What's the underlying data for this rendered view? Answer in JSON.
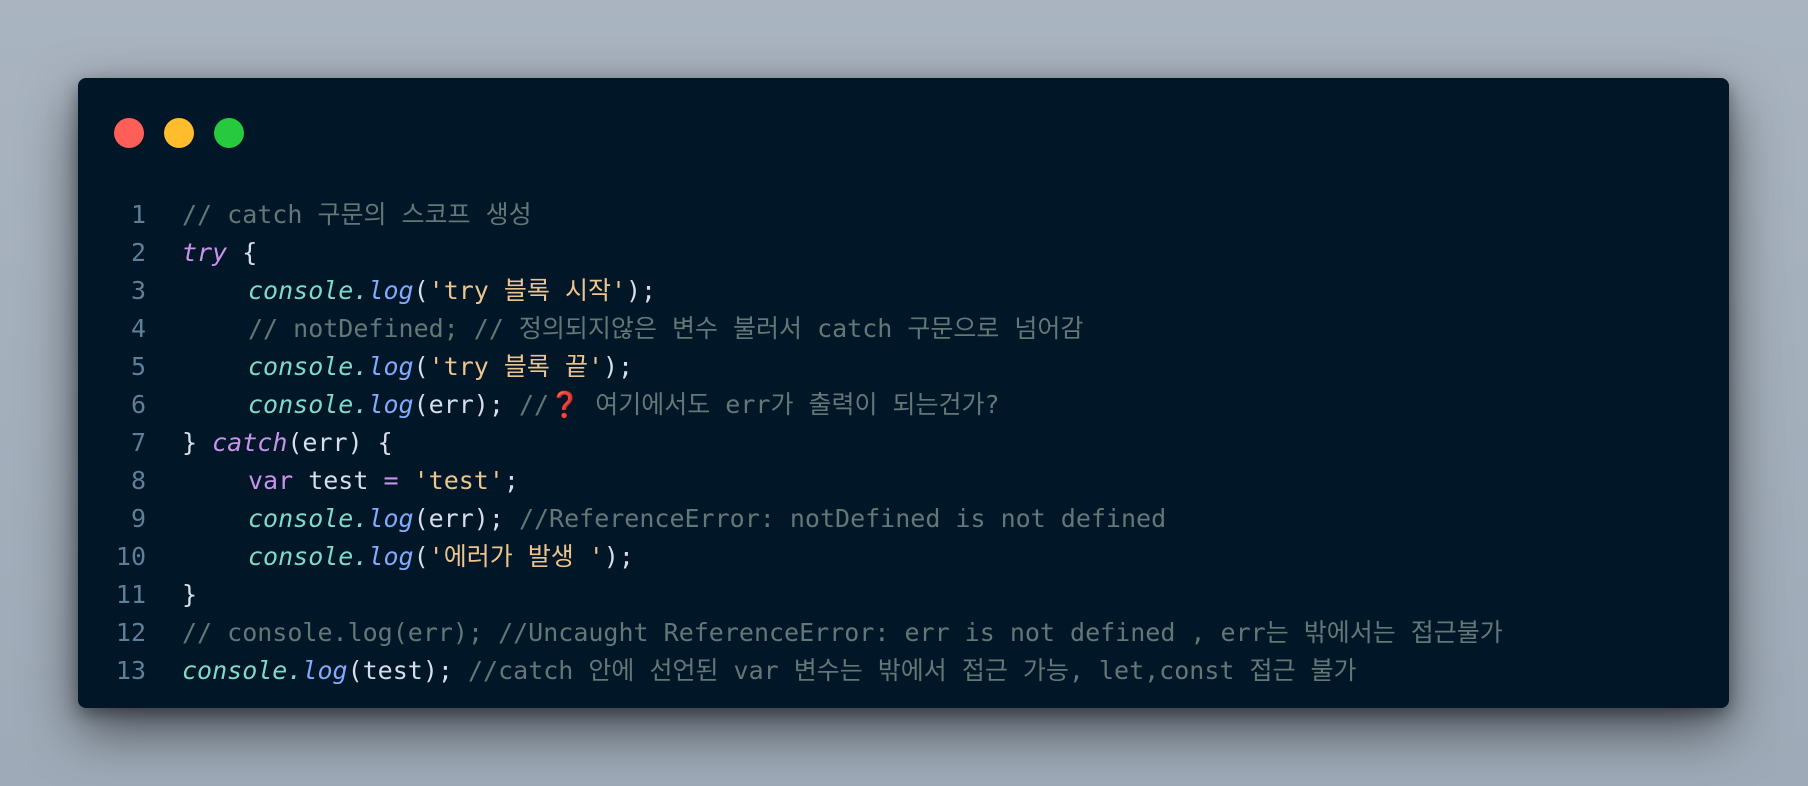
{
  "window": {
    "controls": [
      "close",
      "minimize",
      "maximize"
    ]
  },
  "code": {
    "lines": [
      {
        "no": "1",
        "c0": "// catch 구문의 스코프 생성"
      },
      {
        "no": "2",
        "kw": "try",
        "p0": " {"
      },
      {
        "no": "3",
        "obj": "console",
        "dot": ".",
        "fn": "log",
        "p0": "(",
        "str": "'try 블록 시작'",
        "p1": ");"
      },
      {
        "no": "4",
        "c0": "// notDefined; // 정의되지않은 변수 불러서 catch 구문으로 넘어감"
      },
      {
        "no": "5",
        "obj": "console",
        "dot": ".",
        "fn": "log",
        "p0": "(",
        "str": "'try 블록 끝'",
        "p1": ");"
      },
      {
        "no": "6",
        "obj": "console",
        "dot": ".",
        "fn": "log",
        "p0": "(err); ",
        "c0": "//",
        "emoji": "❓",
        "c1": " 여기에서도 err가 출력이 되는건가?"
      },
      {
        "no": "7",
        "p0": "} ",
        "kw": "catch",
        "p1": "(err) {"
      },
      {
        "no": "8",
        "kwv": "var",
        "p0": " test ",
        "op": "=",
        "p1": " ",
        "str": "'test'",
        "p2": ";"
      },
      {
        "no": "9",
        "obj": "console",
        "dot": ".",
        "fn": "log",
        "p0": "(err); ",
        "c0": "//ReferenceError: notDefined is not defined"
      },
      {
        "no": "10",
        "obj": "console",
        "dot": ".",
        "fn": "log",
        "p0": "(",
        "str": "'에러가 발생 '",
        "p1": ");"
      },
      {
        "no": "11",
        "p0": "}"
      },
      {
        "no": "12",
        "c0": "// console.log(err); //Uncaught ReferenceError: err is not defined , err는 밖에서는 접근불가"
      },
      {
        "no": "13",
        "obj": "console",
        "dot": ".",
        "fn": "log",
        "p0": "(test); ",
        "c0": "//catch 안에 선언된 var 변수는 밖에서 접근 가능, let,const 접근 불가"
      }
    ]
  },
  "colors": {
    "background": "#011627",
    "comment": "#637777",
    "keyword": "#c792ea",
    "object": "#7fdbca",
    "function": "#82aaff",
    "string": "#ecc48d",
    "text": "#d6deeb",
    "line_number": "#5f7e97"
  }
}
